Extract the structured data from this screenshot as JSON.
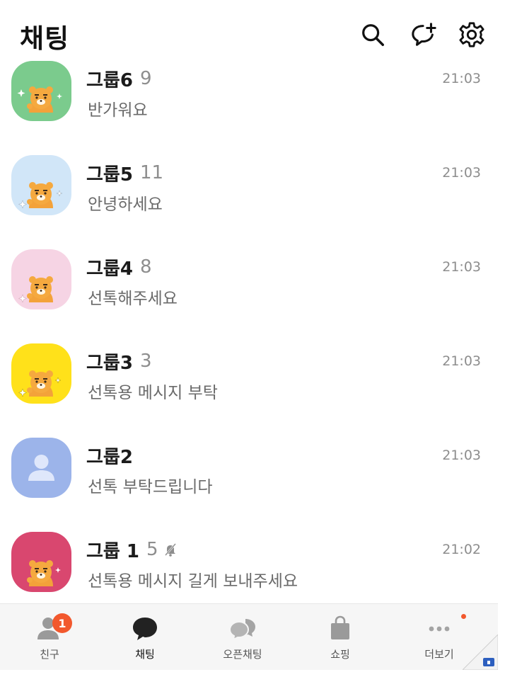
{
  "header": {
    "title": "채팅",
    "icons": [
      "search-icon",
      "new-chat-icon",
      "settings-icon"
    ]
  },
  "chats": [
    {
      "name": "그룹6",
      "count": "9",
      "time": "21:03",
      "message": "반가워요",
      "avatar": "ryan",
      "avatar_bg": "#7bcb8d",
      "muted": false
    },
    {
      "name": "그룹5",
      "count": "11",
      "time": "21:03",
      "message": "안녕하세요",
      "avatar": "ryan",
      "avatar_bg": "#d1e6f8",
      "muted": false
    },
    {
      "name": "그룹4",
      "count": "8",
      "time": "21:03",
      "message": "선톡해주세요",
      "avatar": "ryan",
      "avatar_bg": "#f6d4e4",
      "muted": false
    },
    {
      "name": "그룹3",
      "count": "3",
      "time": "21:03",
      "message": "선톡용 메시지 부탁",
      "avatar": "ryan",
      "avatar_bg": "#ffe11a",
      "muted": false
    },
    {
      "name": "그룹2",
      "count": "",
      "time": "21:03",
      "message": "선톡 부탁드립니다",
      "avatar": "default-person",
      "avatar_bg": "#9cb4ea",
      "muted": false
    },
    {
      "name": "그룹 1",
      "count": "5",
      "time": "21:02",
      "message": "선톡용 메시지 길게 보내주세요",
      "avatar": "ryan",
      "avatar_bg": "#d9476f",
      "muted": true
    }
  ],
  "tabs": [
    {
      "label": "친구",
      "icon": "friends-icon",
      "badge": "1",
      "active": false
    },
    {
      "label": "채팅",
      "icon": "chat-bubble-icon",
      "badge": "",
      "active": true
    },
    {
      "label": "오픈채팅",
      "icon": "open-chat-icon",
      "badge": "",
      "active": false
    },
    {
      "label": "쇼핑",
      "icon": "shopping-bag-icon",
      "badge": "",
      "active": false
    },
    {
      "label": "더보기",
      "icon": "more-icon",
      "badge": "",
      "active": false,
      "dot": true
    }
  ],
  "colors": {
    "badge": "#f2582d",
    "muted_text": "#8e8e8e",
    "tabbar_bg": "#f6f6f6"
  }
}
